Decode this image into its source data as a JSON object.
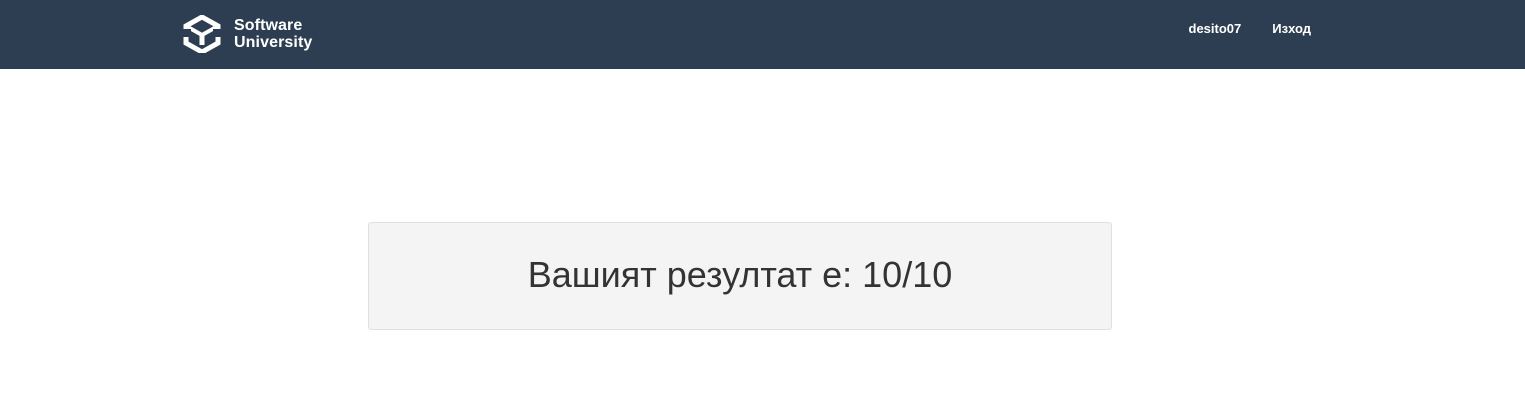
{
  "navbar": {
    "brand": {
      "line1": "Software",
      "line2": "University",
      "logo_icon": "softuni-logo-icon",
      "background_color": "#2e3e52"
    },
    "links": {
      "username": "desito07",
      "logout": "Изход"
    }
  },
  "result": {
    "text": "Вашият резултат е: 10/10"
  }
}
